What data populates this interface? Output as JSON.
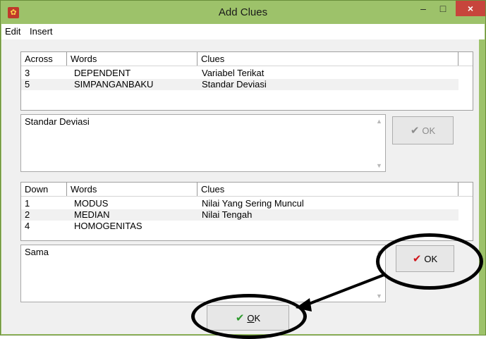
{
  "window": {
    "title": "Add Clues",
    "minimize": "–",
    "maximize": "□",
    "close": "×"
  },
  "menu": [
    {
      "label": "Edit"
    },
    {
      "label": "Insert"
    }
  ],
  "across": {
    "headers": [
      "Across",
      "Words",
      "Clues"
    ],
    "rows": [
      {
        "num": "3",
        "word": "DEPENDENT",
        "clue": "Variabel Terikat"
      },
      {
        "num": "5",
        "word": "SIMPANGANBAKU",
        "clue": "Standar Deviasi"
      }
    ],
    "clue_text": "Standar Deviasi",
    "ok_label": "OK"
  },
  "down": {
    "headers": [
      "Down",
      "Words",
      "Clues"
    ],
    "rows": [
      {
        "num": "1",
        "word": "MODUS",
        "clue": "Nilai Yang Sering Muncul"
      },
      {
        "num": "2",
        "word": "MEDIAN",
        "clue": "Nilai Tengah"
      },
      {
        "num": "4",
        "word": "HOMOGENITAS",
        "clue": ""
      }
    ],
    "clue_text": "Sama",
    "ok_label": "OK"
  },
  "main_ok": {
    "prefix": "",
    "underlined": "O",
    "rest": "K"
  },
  "icons": {
    "check": "✔",
    "up": "▲",
    "down": "▼"
  },
  "colors": {
    "title_bg": "#9dc26a",
    "check_gray": "#8c8c8c",
    "check_red": "#d0141a",
    "check_green": "#2e9a2e"
  }
}
